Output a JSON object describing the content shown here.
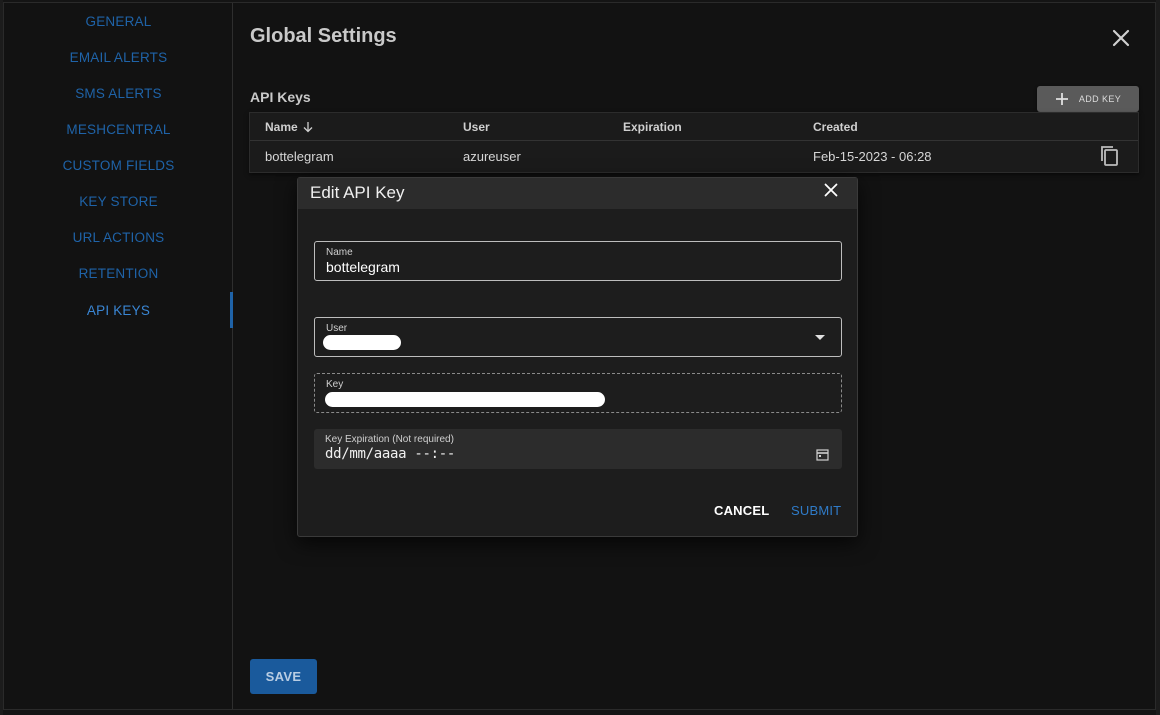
{
  "sidebar": {
    "items": [
      {
        "label": "GENERAL"
      },
      {
        "label": "EMAIL ALERTS"
      },
      {
        "label": "SMS ALERTS"
      },
      {
        "label": "MESHCENTRAL"
      },
      {
        "label": "CUSTOM FIELDS"
      },
      {
        "label": "KEY STORE"
      },
      {
        "label": "URL ACTIONS"
      },
      {
        "label": "RETENTION"
      },
      {
        "label": "API KEYS"
      }
    ],
    "active": "API KEYS"
  },
  "header": {
    "title": "Global Settings",
    "close_icon": "close-icon"
  },
  "api_keys": {
    "section_title": "API Keys",
    "add_button": "ADD KEY",
    "columns": [
      "Name",
      "User",
      "Expiration",
      "Created"
    ],
    "sort_column": "Name",
    "sort_direction": "descending",
    "rows": [
      {
        "name": "bottelegram",
        "user": "azureuser",
        "expiration": "",
        "created": "Feb-15-2023 - 06:28"
      }
    ]
  },
  "footer": {
    "save_label": "SAVE"
  },
  "edit_dialog": {
    "title": "Edit API Key",
    "name_label": "Name",
    "name_value": "bottelegram",
    "user_label": "User",
    "key_label": "Key",
    "expiration_label": "Key Expiration (Not required)",
    "expiration_value": "dd/mm/aaaa --:--",
    "cancel_label": "CANCEL",
    "submit_label": "SUBMIT"
  },
  "colors": {
    "accent": "#1f63a8",
    "save_button": "#1a5a9c",
    "submit_text": "#2f7bc8",
    "background": "#121212"
  }
}
